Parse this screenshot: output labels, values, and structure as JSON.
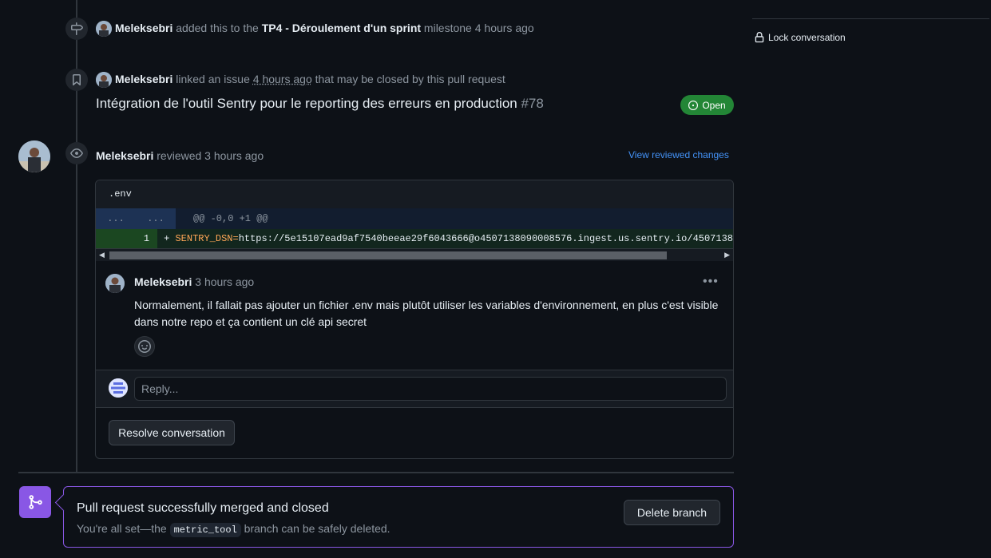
{
  "timeline": {
    "milestone_event": {
      "author": "Meleksebri",
      "pre": "added this to the",
      "milestone": "TP4 - Déroulement d'un sprint",
      "post": "milestone 4 hours ago"
    },
    "link_event": {
      "author": "Meleksebri",
      "pre": "linked an issue",
      "time": "4 hours ago",
      "post": "that may be closed by this pull request"
    },
    "linked_issue": {
      "title": "Intégration de l'outil Sentry pour le reporting des erreurs en production",
      "number": "#78",
      "state": "Open"
    },
    "review_event": {
      "author": "Meleksebri",
      "action": "reviewed 3 hours ago",
      "view_changes": "View reviewed changes"
    }
  },
  "review": {
    "file_name": ".env",
    "hunk": {
      "left_gutter": "...",
      "right_gutter": "...",
      "header": "@@ -0,0 +1 @@"
    },
    "added_line": {
      "line_number": "1",
      "marker": "+",
      "key": "SENTRY_DSN=",
      "value": "https://5e15107ead9af7540beeae29f6043666@o4507138090008576.ingest.us.sentry.io/4507138"
    },
    "comment": {
      "author": "Meleksebri",
      "time": "3 hours ago",
      "menu": "•••",
      "body": "Normalement, il fallait pas ajouter un fichier .env mais plutôt utiliser les variables d'environnement, en plus c'est visible dans notre repo et ça contient un clé api secret"
    },
    "reply_placeholder": "Reply...",
    "resolve_label": "Resolve conversation"
  },
  "merge": {
    "title": "Pull request successfully merged and closed",
    "sub_pre": "You're all set—the",
    "branch": "metric_tool",
    "sub_post": "branch can be safely deleted.",
    "delete_label": "Delete branch"
  },
  "sidebar": {
    "lock_label": "Lock conversation"
  },
  "colors": {
    "background": "#0d1117",
    "open_green": "#238636",
    "merged_purple": "#8957e5",
    "link_blue": "#4493f8"
  },
  "icons": [
    "milestone-icon",
    "cross-reference-icon",
    "eye-icon",
    "issue-opened-icon",
    "smiley-icon",
    "git-merge-icon",
    "lock-icon",
    "kebab-menu-icon"
  ]
}
